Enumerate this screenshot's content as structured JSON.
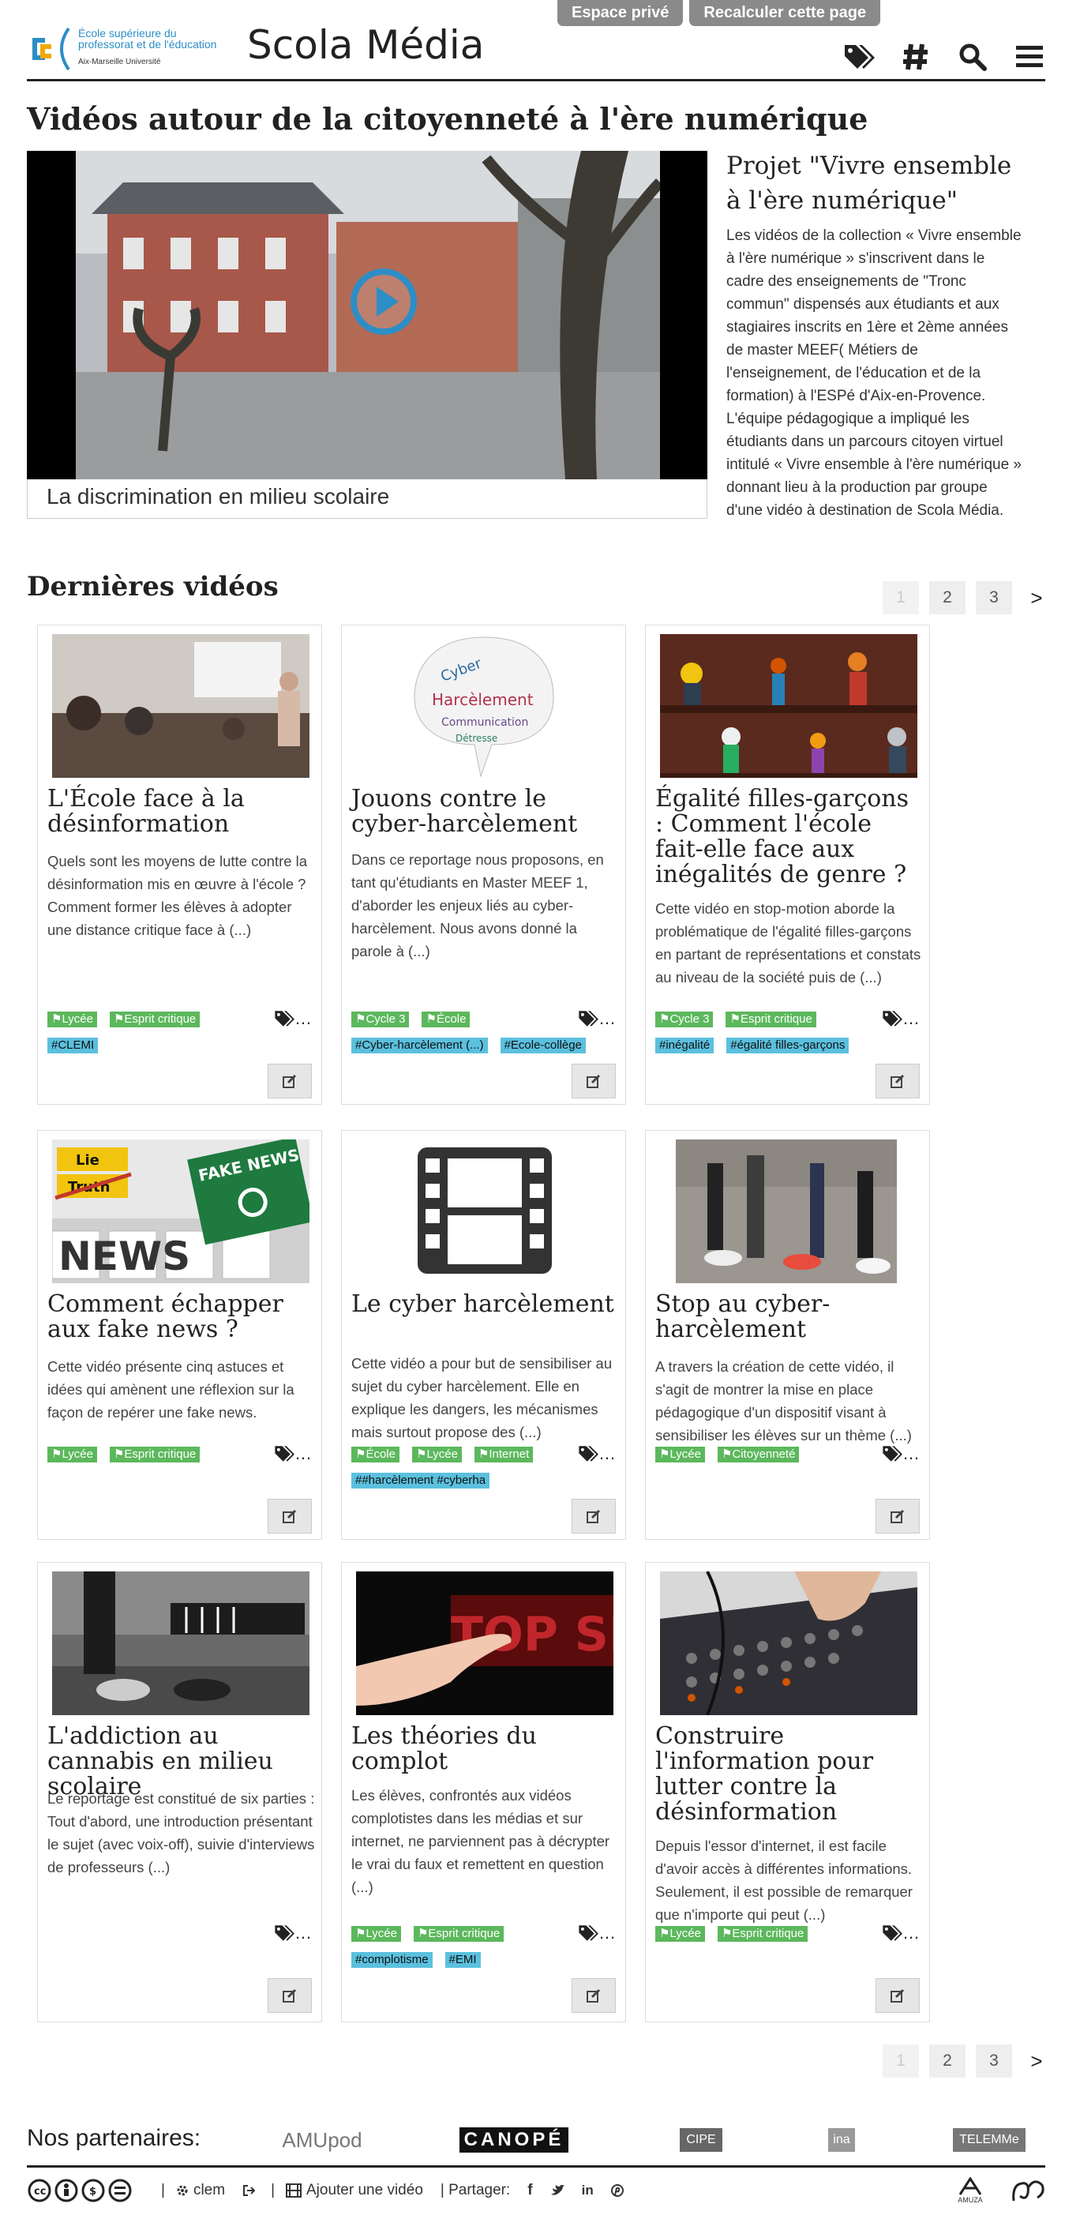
{
  "header": {
    "admin_private": "Espace privé",
    "admin_recalc": "Recalculer cette page",
    "logo_line1": "École supérieure du",
    "logo_line2": "professorat et de l'éducation",
    "logo_line3": "Aix-Marseille Université",
    "site_title": "Scola Média",
    "icons": [
      "tags-icon",
      "hashtag-icon",
      "search-icon",
      "menu-icon"
    ]
  },
  "featured": {
    "section_title": "Vidéos autour de la citoyenneté à l'ère numérique",
    "video_caption": "La discrimination en milieu scolaire",
    "project_title": "Projet \"Vivre ensemble à l'ère numérique\"",
    "project_text": "Les vidéos de la collection « Vivre ensemble à l'ère numérique » s'inscrivent dans le cadre des enseignements de \"Tronc commun\" dispensés aux étudiants et aux stagiaires inscrits en 1ère et 2ème années de master MEEF( Métiers de l'enseignement, de l'éducation et de la formation) à l'ESPé d'Aix-en-Provence. L'équipe pédagogique a impliqué les étudiants dans un parcours citoyen virtuel intitulé « Vivre ensemble à l'ère numérique » donnant lieu à la production par groupe d'une vidéo à destination de Scola Média."
  },
  "latest": {
    "section_title": "Dernières vidéos",
    "pages": [
      "1",
      "2",
      "3"
    ],
    "next": ">",
    "tags_more": "…",
    "cards": [
      {
        "title": "L'École face à la désinformation",
        "desc": "Quels sont les moyens de lutte contre la désinformation mis en œuvre à l'école ? Comment former les élèves à adopter une distance critique face à (...)",
        "tags": [
          "Lycée",
          "Esprit critique"
        ],
        "keywords": [
          "CLEMI"
        ]
      },
      {
        "title": "Jouons contre le cyber-harcèlement",
        "desc": "Dans ce reportage nous proposons, en tant qu'étudiants en Master MEEF 1, d'aborder les enjeux liés au cyber-harcèlement. Nous avons donné la parole à (...)",
        "tags": [
          "Cycle 3",
          "École"
        ],
        "keywords": [
          "Cyber-harcèlement (...)",
          "Ecole-collège"
        ]
      },
      {
        "title": "Égalité filles-garçons : Comment l'école fait-elle face aux inégalités de genre ?",
        "desc": "Cette vidéo en stop-motion aborde la problématique de l'égalité filles-garçons en partant de représentations et constats au niveau de la société puis de (...)",
        "tags": [
          "Cycle 3",
          "Esprit critique"
        ],
        "keywords": [
          "inégalité",
          "égalité filles-garçons"
        ]
      },
      {
        "title": "Comment échapper aux fake news ?",
        "desc": "Cette vidéo présente cinq astuces et idées qui amènent une réflexion sur la façon de repérer une fake news.",
        "tags": [
          "Lycée",
          "Esprit critique"
        ],
        "keywords": []
      },
      {
        "title": "Le cyber harcèlement",
        "desc": "Cette vidéo a pour but de sensibiliser au sujet du cyber harcèlement. Elle en explique les dangers, les mécanismes mais surtout propose des (...)",
        "tags": [
          "École",
          "Lycée",
          "Internet"
        ],
        "keywords": [
          "#harcèlement #cyberha"
        ]
      },
      {
        "title": "Stop au cyber-harcèlement",
        "desc": "A travers la création de cette vidéo, il s'agit de montrer la mise en place pédagogique d'un dispositif visant à sensibiliser les élèves sur un thème (...)",
        "tags": [
          "Lycée",
          "Citoyenneté"
        ],
        "keywords": []
      },
      {
        "title": "L'addiction au cannabis en milieu scolaire",
        "desc": "Le reportage est constitué de six parties : Tout d'abord, une introduction présentant le sujet (avec voix-off), suivie d'interviews de professeurs (...)",
        "tags": [],
        "keywords": []
      },
      {
        "title": "Les théories du complot",
        "desc": "Les élèves, confrontés aux vidéos complotistes dans les médias et sur internet, ne parviennent pas à décrypter le vrai du faux et remettent en question (...)",
        "tags": [
          "Lycée",
          "Esprit critique"
        ],
        "keywords": [
          "complotisme",
          "EMI"
        ]
      },
      {
        "title": "Construire l'information pour lutter contre la désinformation",
        "desc": "Depuis l'essor d'internet, il est facile d'avoir accès à différentes informations. Seulement, il est possible de remarquer que n'importe qui peut (...)",
        "tags": [
          "Lycée",
          "Esprit critique"
        ],
        "keywords": []
      }
    ],
    "thumb_texts": {
      "fake_news_lie": "Lie",
      "fake_news_truth": "Truth",
      "fake_news_sign": "FAKE NEWS",
      "fake_news_word": "NEWS",
      "top_secret": "TOP SECRE"
    }
  },
  "partners": {
    "title": "Nos partenaires:",
    "logos": [
      "AMUpod",
      "CANOPÉ",
      "CIPE",
      "ina",
      "TELEMMe"
    ]
  },
  "footer": {
    "user": "clem",
    "add_video": "Ajouter une vidéo",
    "share": "| Partager:",
    "pipe": "|",
    "brand": "AMUZA"
  }
}
